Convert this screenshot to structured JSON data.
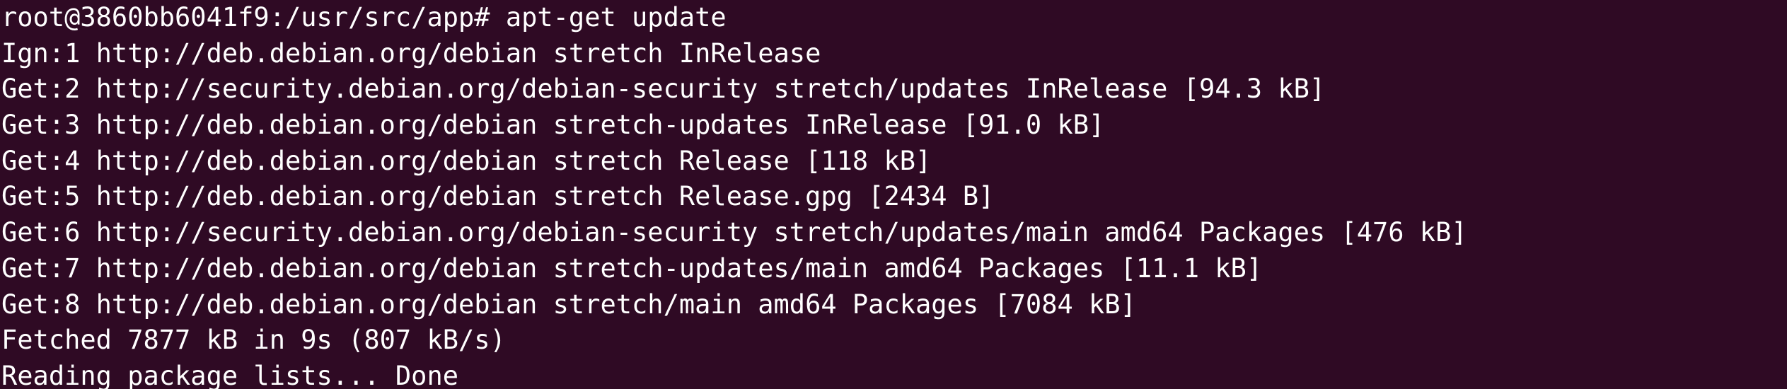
{
  "terminal": {
    "lines": [
      "root@3860bb6041f9:/usr/src/app# apt-get update",
      "Ign:1 http://deb.debian.org/debian stretch InRelease",
      "Get:2 http://security.debian.org/debian-security stretch/updates InRelease [94.3 kB]",
      "Get:3 http://deb.debian.org/debian stretch-updates InRelease [91.0 kB]",
      "Get:4 http://deb.debian.org/debian stretch Release [118 kB]",
      "Get:5 http://deb.debian.org/debian stretch Release.gpg [2434 B]",
      "Get:6 http://security.debian.org/debian-security stretch/updates/main amd64 Packages [476 kB]",
      "Get:7 http://deb.debian.org/debian stretch-updates/main amd64 Packages [11.1 kB]",
      "Get:8 http://deb.debian.org/debian stretch/main amd64 Packages [7084 kB]",
      "Fetched 7877 kB in 9s (807 kB/s)",
      "Reading package lists... Done"
    ],
    "colors": {
      "background": "#2f0a24",
      "text": "#ffffff"
    }
  }
}
